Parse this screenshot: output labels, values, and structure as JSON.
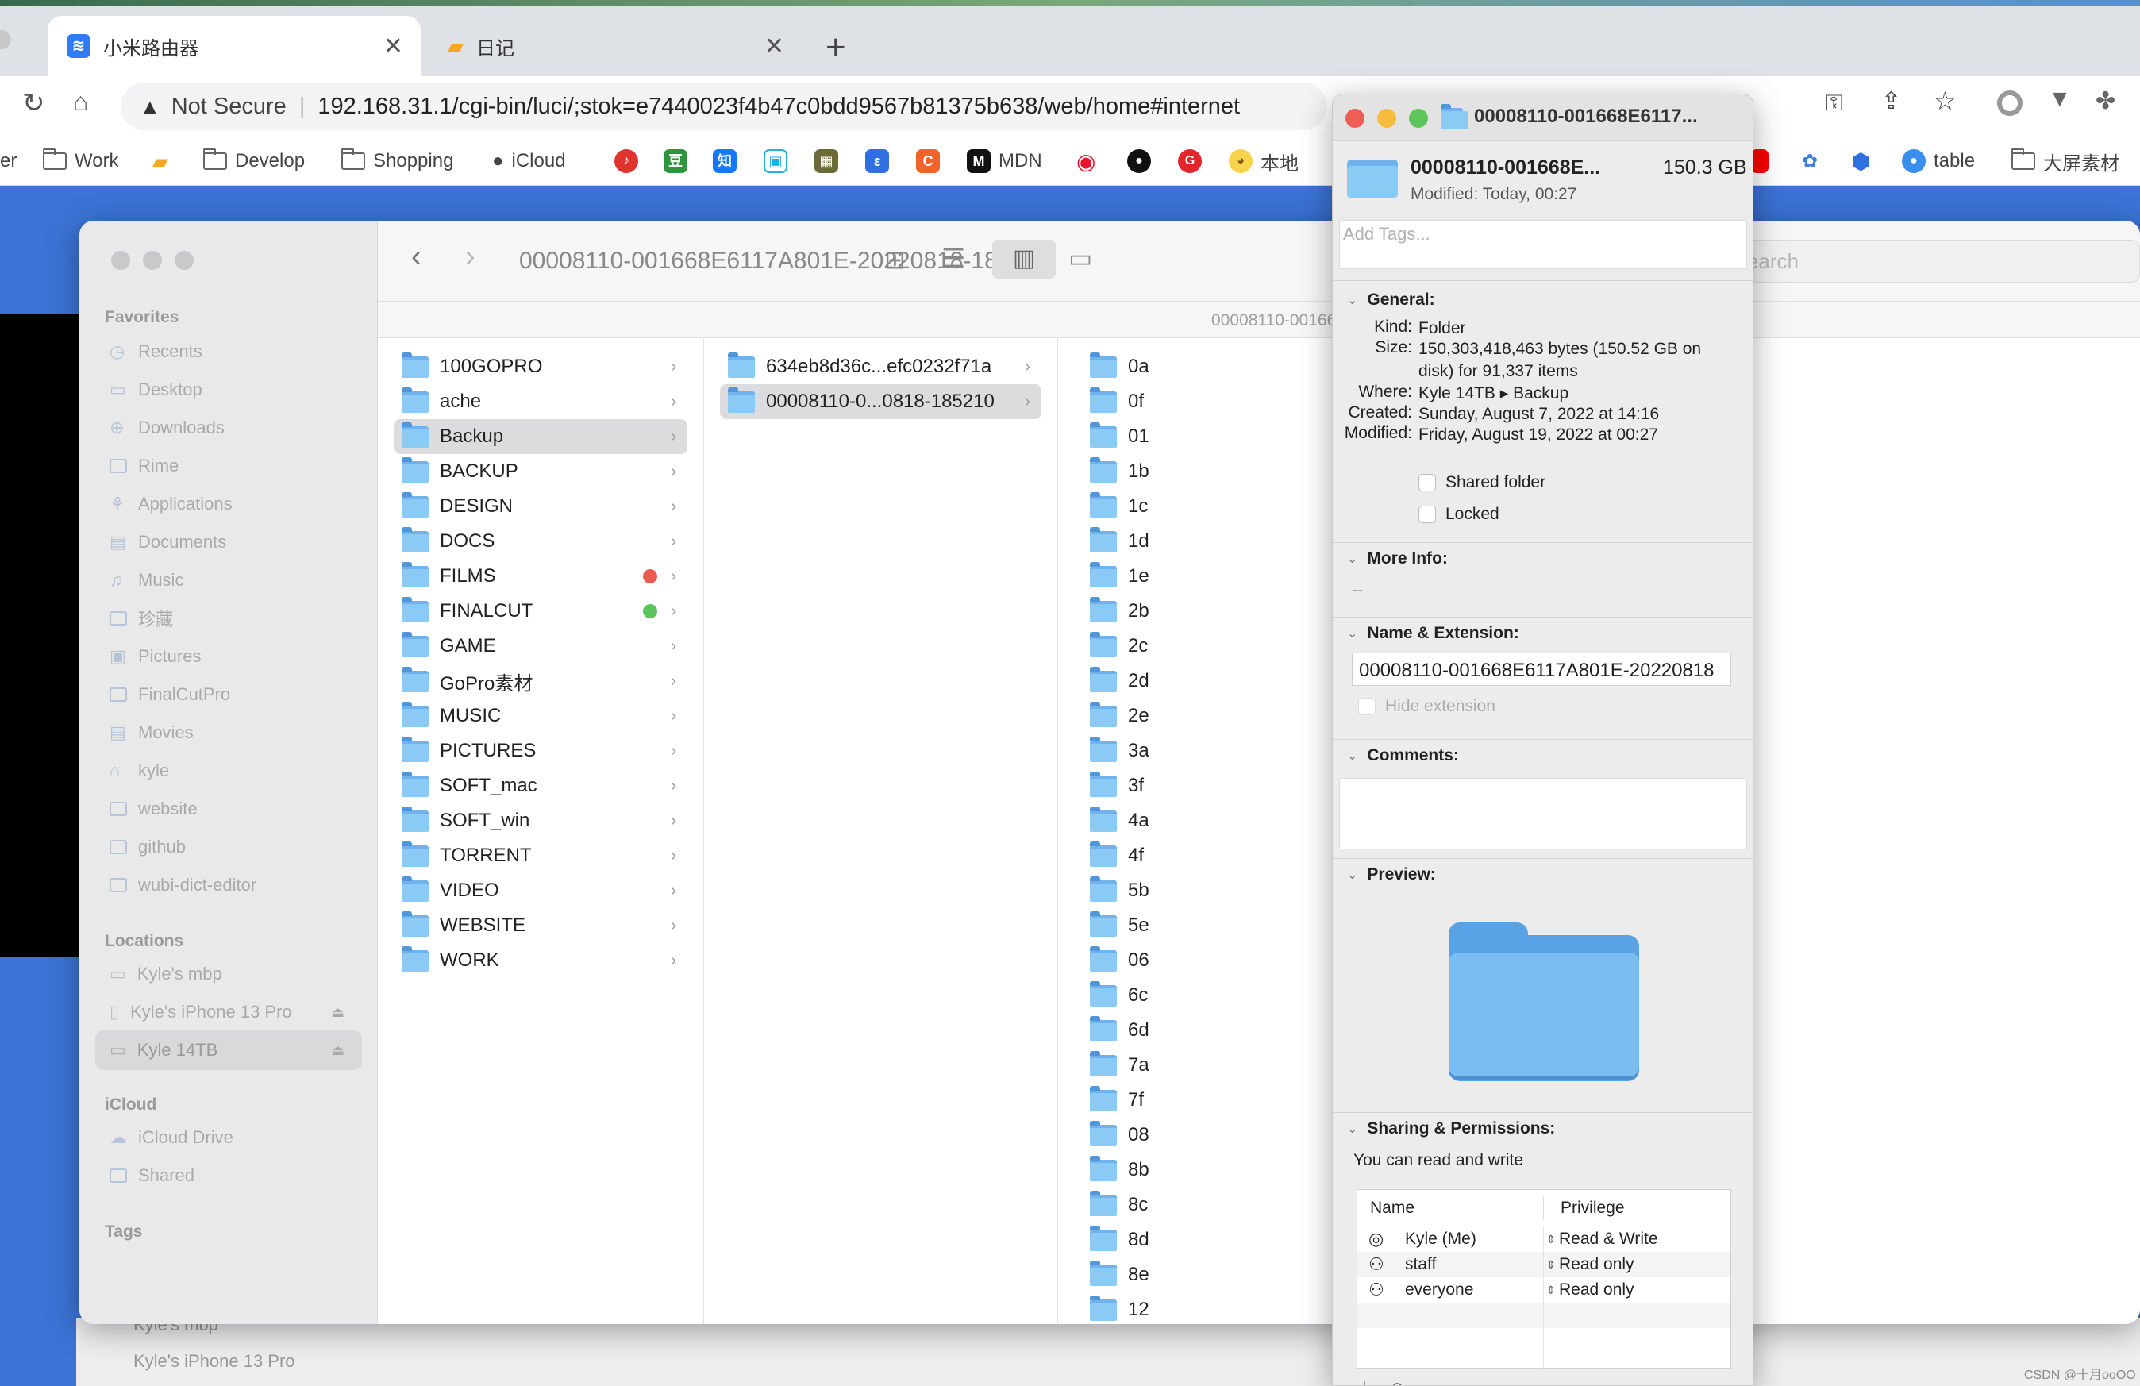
{
  "browser": {
    "tabs": [
      {
        "title": "小米路由器",
        "active": true
      },
      {
        "title": "日记",
        "active": false
      }
    ],
    "url_warning": "Not Secure",
    "url": "192.168.31.1/cgi-bin/luci/;stok=e7440023f4b47c0bdd9567b81375b638/web/home#internet",
    "bookmarks": [
      "er",
      "Work",
      "Develop",
      "Shopping",
      "iCloud",
      "MDN",
      "本地",
      "table",
      "大屏素材"
    ]
  },
  "finder": {
    "title": "00008110-001668E6117A801E-20220818-185210",
    "path_bar": "00008110-001668E6117",
    "search_placeholder": "Search",
    "sidebar": {
      "favorites_label": "Favorites",
      "favorites": [
        "Recents",
        "Desktop",
        "Downloads",
        "Rime",
        "Applications",
        "Documents",
        "Music",
        "珍藏",
        "Pictures",
        "FinalCutPro",
        "Movies",
        "kyle",
        "website",
        "github",
        "wubi-dict-editor"
      ],
      "locations_label": "Locations",
      "locations": [
        "Kyle's mbp",
        "Kyle's iPhone 13 Pro",
        "Kyle 14TB"
      ],
      "icloud_label": "iCloud",
      "icloud": [
        "iCloud Drive",
        "Shared"
      ],
      "tags_label": "Tags",
      "behind": [
        "Kyle's mbp",
        "Kyle's iPhone 13 Pro"
      ]
    },
    "col1": [
      "100GOPRO",
      "ache",
      "Backup",
      "BACKUP",
      "DESIGN",
      "DOCS",
      "FILMS",
      "FINALCUT",
      "GAME",
      "GoPro素材",
      "MUSIC",
      "PICTURES",
      "SOFT_mac",
      "SOFT_win",
      "TORRENT",
      "VIDEO",
      "WEBSITE",
      "WORK"
    ],
    "col1_selected": "Backup",
    "tag_colors": {
      "FILMS": "#ec5b4f",
      "FINALCUT": "#5bc55b"
    },
    "col2": [
      "634eb8d36c...efc0232f71a",
      "00008110-0...0818-185210"
    ],
    "col2_selected": "00008110-0...0818-185210",
    "col3": [
      "0a",
      "0f",
      "01",
      "1b",
      "1c",
      "1d",
      "1e",
      "2b",
      "2c",
      "2d",
      "2e",
      "3a",
      "3f",
      "4a",
      "4f",
      "5b",
      "5e",
      "06",
      "6c",
      "6d",
      "7a",
      "7f",
      "08",
      "8b",
      "8c",
      "8d",
      "8e",
      "12"
    ]
  },
  "info": {
    "title": "00008110-001668E6117...",
    "name": "00008110-001668E...",
    "size": "150.3 GB",
    "modified_line": "Modified: Today, 00:27",
    "tags_placeholder": "Add Tags...",
    "general_label": "General:",
    "general": [
      {
        "k": "Kind:",
        "v": "Folder"
      },
      {
        "k": "Size:",
        "v": "150,303,418,463 bytes (150.52 GB on disk) for 91,337 items"
      },
      {
        "k": "Where:",
        "v": "Kyle 14TB ▸ Backup"
      },
      {
        "k": "Created:",
        "v": "Sunday, August 7, 2022 at 14:16"
      },
      {
        "k": "Modified:",
        "v": "Friday, August 19, 2022 at 00:27"
      }
    ],
    "shared_folder": "Shared folder",
    "locked": "Locked",
    "more_info_label": "More Info:",
    "more_info_value": "--",
    "name_ext_label": "Name & Extension:",
    "name_field": "00008110-001668E6117A801E-20220818",
    "hide_extension": "Hide extension",
    "comments_label": "Comments:",
    "preview_label": "Preview:",
    "sharing_label": "Sharing & Permissions:",
    "sharing_note": "You can read and write",
    "perm_headers": [
      "Name",
      "Privilege"
    ],
    "permissions": [
      {
        "name": "Kyle (Me)",
        "priv": "Read & Write"
      },
      {
        "name": "staff",
        "priv": "Read only"
      },
      {
        "name": "everyone",
        "priv": "Read only"
      }
    ]
  },
  "watermark": "CSDN @十月ooOO"
}
